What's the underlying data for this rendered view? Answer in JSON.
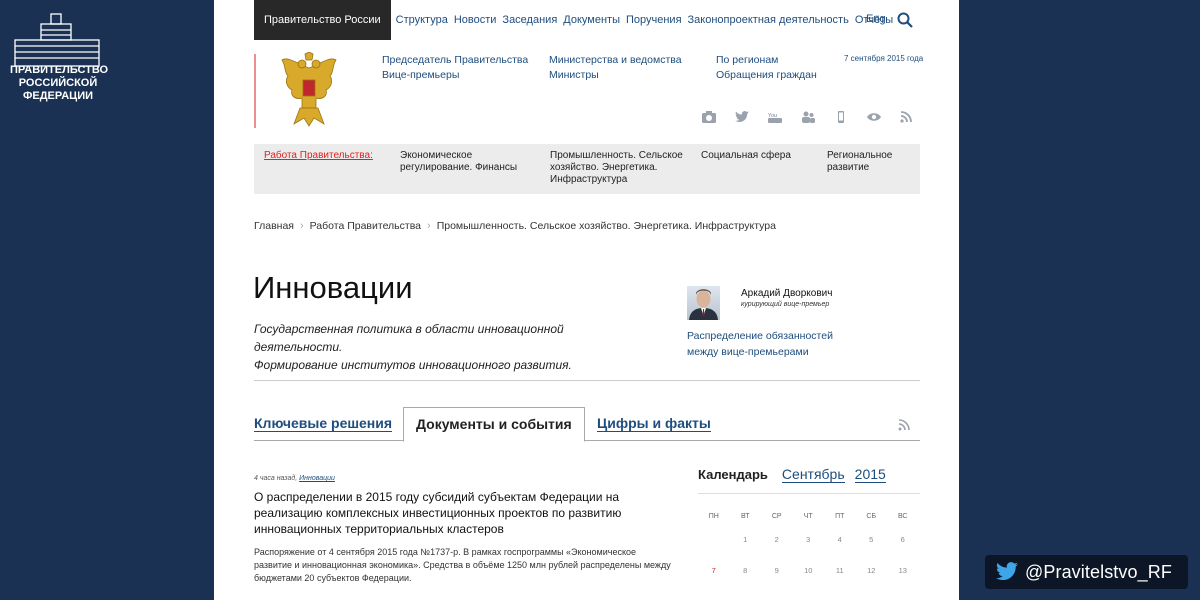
{
  "side_logo": {
    "line1": "ПРАВИТЕЛЬСТВО",
    "line2": "РОССИЙСКОЙ",
    "line3": "ФЕДЕРАЦИИ"
  },
  "twitter": {
    "handle": "@Pravitelstvo_RF"
  },
  "topnav": {
    "current": "Правительство России",
    "links": [
      "Структура",
      "Новости",
      "Заседания",
      "Документы",
      "Поручения",
      "Законопроектная деятельность",
      "Отчёты"
    ],
    "lang": "Eng"
  },
  "header": {
    "col1": [
      "Председатель Правительства",
      "Вице-премьеры"
    ],
    "col2": [
      "Министерства и ведомства",
      "Министры"
    ],
    "col3": [
      "По регионам",
      "Обращения граждан"
    ],
    "date": "7 сентября 2015 года"
  },
  "workbar": {
    "label": "Работа Правительства:",
    "items": [
      "Экономическое регулирование. Финансы",
      "Промышленность. Сельское хозяйство. Энергетика. Инфраструктура",
      "Социальная сфера",
      "Региональное развитие"
    ]
  },
  "breadcrumb": [
    "Главная",
    "Работа Правительства",
    "Промышленность. Сельское хозяйство. Энергетика. Инфраструктура"
  ],
  "page": {
    "title": "Инновации",
    "lead_1": "Государственная политика в области инновационной деятельности.",
    "lead_2": "Формирование институтов инновационного развития."
  },
  "person": {
    "name": "Аркадий Дворкович",
    "role": "курирующий вице-премьер",
    "link_1": "Распределение обязанностей",
    "link_2": "между вице-премьерами"
  },
  "tabs": [
    "Ключевые решения",
    "Документы и события",
    "Цифры и факты"
  ],
  "news": {
    "time": "4 часа назад,",
    "tag": "Инновации",
    "title": "О распределении в 2015 году субсидий субъектам Федерации на реализацию комплексных инвестиционных проектов по развитию инновационных территориальных кластеров",
    "text": "Распоряжение от 4 сентября 2015 года №1737-р. В рамках госпрограммы «Экономическое развитие и инновационная экономика». Средства в объёме 1250 млн рублей распределены между бюджетами 20 субъектов Федерации."
  },
  "calendar": {
    "label": "Календарь",
    "month": "Сентябрь",
    "year": "2015",
    "dow": [
      "ПН",
      "ВТ",
      "СР",
      "ЧТ",
      "ПТ",
      "СБ",
      "ВС"
    ],
    "week1": [
      "",
      "1",
      "2",
      "3",
      "4",
      "5",
      "6"
    ],
    "week2": [
      "7",
      "8",
      "9",
      "10",
      "11",
      "12",
      "13"
    ]
  },
  "colors": {
    "navy": "#1b3153",
    "link": "#1f4d7d",
    "accent_red": "#dd2222"
  }
}
